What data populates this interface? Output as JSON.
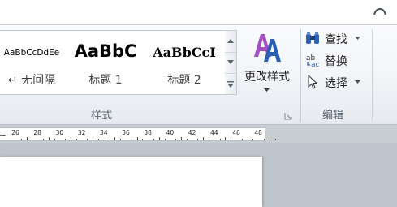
{
  "styles_gallery": {
    "tiles": [
      {
        "sample": "AaBbCcDdEe",
        "name": "↵ 无间隔"
      },
      {
        "sample": "AaBbC",
        "name": "标题 1"
      },
      {
        "sample": "AaBbCcI",
        "name": "标题 2"
      }
    ],
    "group_label": "样式"
  },
  "change_styles": {
    "label": "更改样式"
  },
  "editing": {
    "find_label": "查找",
    "replace_label": "替换",
    "select_label": "选择",
    "group_label": "编辑"
  },
  "ruler": {
    "ticks": [
      "26",
      "28",
      "30",
      "32",
      "34",
      "36",
      "38",
      "40",
      "42",
      "44",
      "46",
      "48"
    ]
  },
  "colors": {
    "accent_blue": "#2b5fb4",
    "change_styles_purple": "#a24fc2"
  }
}
